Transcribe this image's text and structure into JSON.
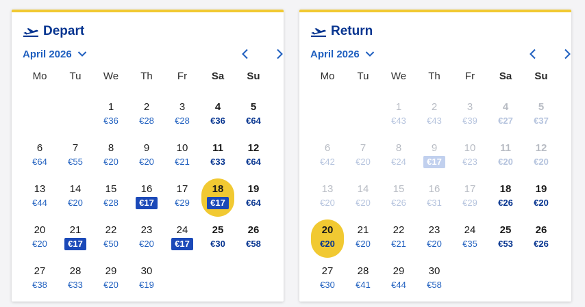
{
  "icons": {
    "plane": "plane-takeoff-icon",
    "prev": "chevron-left-icon",
    "next": "chevron-right-icon",
    "dropdown": "chevron-down-icon"
  },
  "colors": {
    "accent": "#f1c932",
    "brand": "#073590",
    "link": "#1f5fbf",
    "cheap_badge": "#1b49b8"
  },
  "weekdays": [
    "Mo",
    "Tu",
    "We",
    "Th",
    "Fr",
    "Sa",
    "Su"
  ],
  "panels": [
    {
      "id": "depart",
      "title": "Depart",
      "month_label": "April 2026",
      "leading_blanks": 2,
      "days": [
        {
          "day": "1",
          "price": "€36"
        },
        {
          "day": "2",
          "price": "€28"
        },
        {
          "day": "3",
          "price": "€28"
        },
        {
          "day": "4",
          "price": "€36"
        },
        {
          "day": "5",
          "price": "€64"
        },
        {
          "day": "6",
          "price": "€64"
        },
        {
          "day": "7",
          "price": "€55"
        },
        {
          "day": "8",
          "price": "€20"
        },
        {
          "day": "9",
          "price": "€20"
        },
        {
          "day": "10",
          "price": "€21"
        },
        {
          "day": "11",
          "price": "€33"
        },
        {
          "day": "12",
          "price": "€64"
        },
        {
          "day": "13",
          "price": "€44"
        },
        {
          "day": "14",
          "price": "€20"
        },
        {
          "day": "15",
          "price": "€28"
        },
        {
          "day": "16",
          "price": "€17",
          "cheap": true
        },
        {
          "day": "17",
          "price": "€29"
        },
        {
          "day": "18",
          "price": "€17",
          "cheap": true,
          "selected": true
        },
        {
          "day": "19",
          "price": "€64"
        },
        {
          "day": "20",
          "price": "€20"
        },
        {
          "day": "21",
          "price": "€17",
          "cheap": true
        },
        {
          "day": "22",
          "price": "€50"
        },
        {
          "day": "23",
          "price": "€20"
        },
        {
          "day": "24",
          "price": "€17",
          "cheap": true
        },
        {
          "day": "25",
          "price": "€30"
        },
        {
          "day": "26",
          "price": "€58"
        },
        {
          "day": "27",
          "price": "€38"
        },
        {
          "day": "28",
          "price": "€33"
        },
        {
          "day": "29",
          "price": "€20"
        },
        {
          "day": "30",
          "price": "€19"
        }
      ]
    },
    {
      "id": "return",
      "title": "Return",
      "month_label": "April 2026",
      "leading_blanks": 2,
      "days": [
        {
          "day": "1",
          "price": "€43",
          "disabled": true
        },
        {
          "day": "2",
          "price": "€43",
          "disabled": true
        },
        {
          "day": "3",
          "price": "€39",
          "disabled": true
        },
        {
          "day": "4",
          "price": "€27",
          "disabled": true
        },
        {
          "day": "5",
          "price": "€37",
          "disabled": true
        },
        {
          "day": "6",
          "price": "€42",
          "disabled": true
        },
        {
          "day": "7",
          "price": "€20",
          "disabled": true
        },
        {
          "day": "8",
          "price": "€24",
          "disabled": true
        },
        {
          "day": "9",
          "price": "€17",
          "disabled": true,
          "cheap": true
        },
        {
          "day": "10",
          "price": "€23",
          "disabled": true
        },
        {
          "day": "11",
          "price": "€20",
          "disabled": true
        },
        {
          "day": "12",
          "price": "€20",
          "disabled": true
        },
        {
          "day": "13",
          "price": "€20",
          "disabled": true
        },
        {
          "day": "14",
          "price": "€20",
          "disabled": true
        },
        {
          "day": "15",
          "price": "€26",
          "disabled": true
        },
        {
          "day": "16",
          "price": "€31",
          "disabled": true
        },
        {
          "day": "17",
          "price": "€29",
          "disabled": true
        },
        {
          "day": "18",
          "price": "€26"
        },
        {
          "day": "19",
          "price": "€20"
        },
        {
          "day": "20",
          "price": "€20",
          "selected": true
        },
        {
          "day": "21",
          "price": "€20"
        },
        {
          "day": "22",
          "price": "€21"
        },
        {
          "day": "23",
          "price": "€20"
        },
        {
          "day": "24",
          "price": "€35"
        },
        {
          "day": "25",
          "price": "€53"
        },
        {
          "day": "26",
          "price": "€26"
        },
        {
          "day": "27",
          "price": "€30"
        },
        {
          "day": "28",
          "price": "€41"
        },
        {
          "day": "29",
          "price": "€44"
        },
        {
          "day": "30",
          "price": "€58"
        }
      ]
    }
  ]
}
